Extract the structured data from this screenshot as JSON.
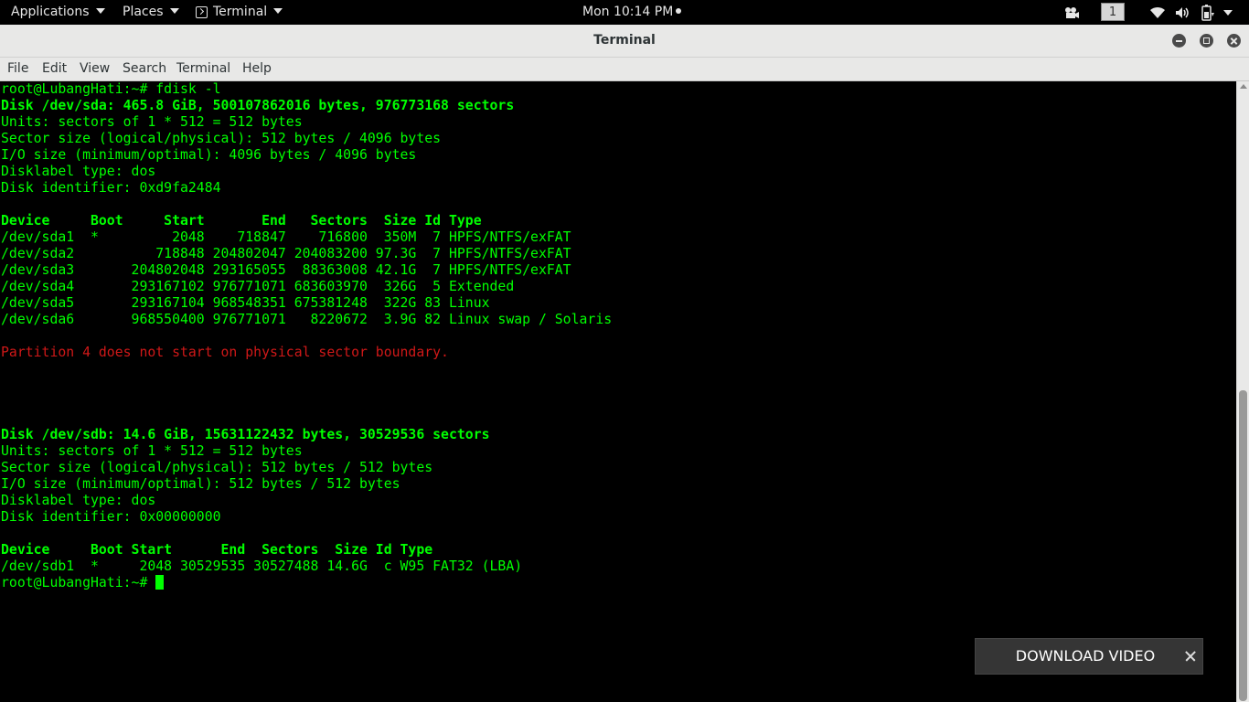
{
  "topbar": {
    "applications": "Applications",
    "places": "Places",
    "app_name": "Terminal",
    "clock": "Mon 10:14 PM",
    "workspace": "1",
    "icons": [
      "video-camera-icon",
      "wifi-icon",
      "volume-icon",
      "battery-icon",
      "power-menu-icon"
    ]
  },
  "window": {
    "title": "Terminal",
    "controls": [
      "minimize-icon",
      "maximize-icon",
      "close-icon"
    ]
  },
  "menu": [
    "File",
    "Edit",
    "View",
    "Search",
    "Terminal",
    "Help"
  ],
  "terminal": {
    "text_color": "#00ff00",
    "error_color": "#d01818",
    "lines": [
      {
        "text": "root@LubangHati:~# fdisk -l",
        "style": "normal"
      },
      {
        "text": "Disk /dev/sda: 465.8 GiB, 500107862016 bytes, 976773168 sectors",
        "style": "bold"
      },
      {
        "text": "Units: sectors of 1 * 512 = 512 bytes",
        "style": "normal"
      },
      {
        "text": "Sector size (logical/physical): 512 bytes / 4096 bytes",
        "style": "normal"
      },
      {
        "text": "I/O size (minimum/optimal): 4096 bytes / 4096 bytes",
        "style": "normal"
      },
      {
        "text": "Disklabel type: dos",
        "style": "normal"
      },
      {
        "text": "Disk identifier: 0xd9fa2484",
        "style": "normal"
      },
      {
        "text": "",
        "style": "normal"
      },
      {
        "text": "Device     Boot     Start       End   Sectors  Size Id Type",
        "style": "bold"
      },
      {
        "text": "/dev/sda1  *         2048    718847    716800  350M  7 HPFS/NTFS/exFAT",
        "style": "normal"
      },
      {
        "text": "/dev/sda2          718848 204802047 204083200 97.3G  7 HPFS/NTFS/exFAT",
        "style": "normal"
      },
      {
        "text": "/dev/sda3       204802048 293165055  88363008 42.1G  7 HPFS/NTFS/exFAT",
        "style": "normal"
      },
      {
        "text": "/dev/sda4       293167102 976771071 683603970  326G  5 Extended",
        "style": "normal"
      },
      {
        "text": "/dev/sda5       293167104 968548351 675381248  322G 83 Linux",
        "style": "normal"
      },
      {
        "text": "/dev/sda6       968550400 976771071   8220672  3.9G 82 Linux swap / Solaris",
        "style": "normal"
      },
      {
        "text": "",
        "style": "normal"
      },
      {
        "text": "Partition 4 does not start on physical sector boundary.",
        "style": "red"
      },
      {
        "text": "",
        "style": "normal"
      },
      {
        "text": "",
        "style": "normal"
      },
      {
        "text": "",
        "style": "normal"
      },
      {
        "text": "",
        "style": "normal"
      },
      {
        "text": "Disk /dev/sdb: 14.6 GiB, 15631122432 bytes, 30529536 sectors",
        "style": "bold"
      },
      {
        "text": "Units: sectors of 1 * 512 = 512 bytes",
        "style": "normal"
      },
      {
        "text": "Sector size (logical/physical): 512 bytes / 512 bytes",
        "style": "normal"
      },
      {
        "text": "I/O size (minimum/optimal): 512 bytes / 512 bytes",
        "style": "normal"
      },
      {
        "text": "Disklabel type: dos",
        "style": "normal"
      },
      {
        "text": "Disk identifier: 0x00000000",
        "style": "normal"
      },
      {
        "text": "",
        "style": "normal"
      },
      {
        "text": "Device     Boot Start      End  Sectors  Size Id Type",
        "style": "bold"
      },
      {
        "text": "/dev/sdb1  *     2048 30529535 30527488 14.6G  c W95 FAT32 (LBA)",
        "style": "normal"
      }
    ],
    "prompt": "root@LubangHati:~# "
  },
  "popup": {
    "label": "DOWNLOAD VIDEO"
  }
}
